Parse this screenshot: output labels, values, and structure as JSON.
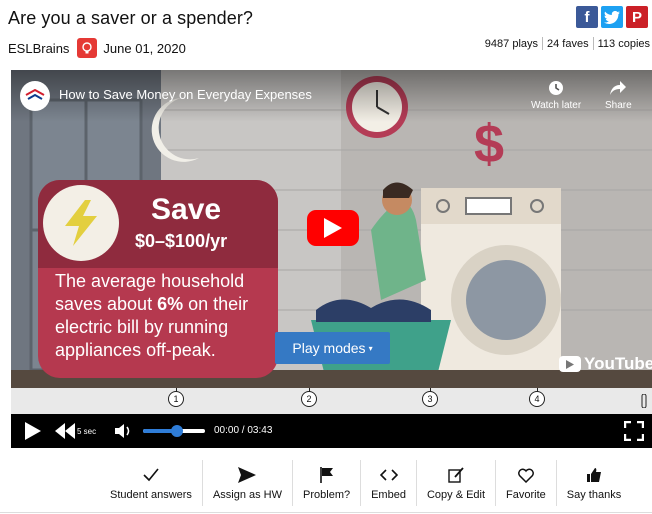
{
  "header": {
    "title": "Are you a saver or a spender?",
    "author": "ESLBrains",
    "date": "June 01, 2020",
    "share": {
      "facebook": "f",
      "twitter": "t",
      "pinterest": "P"
    },
    "stats": {
      "plays": "9487 plays",
      "faves": "24 faves",
      "copies": "113 copies"
    }
  },
  "video": {
    "title": "How to Save Money on Everyday Expenses",
    "watch_later": "Watch later",
    "share": "Share",
    "card": {
      "headline": "Save",
      "range": "$0–$100/yr",
      "body_pre": "The average household saves about ",
      "body_bold": "6%",
      "body_post": " on their electric bill by running appliances off-peak."
    },
    "play_modes": "Play modes",
    "youtube_wordmark": "YouTube"
  },
  "timeline": {
    "markers": [
      "1",
      "2",
      "3",
      "4"
    ],
    "marker_positions_pct": [
      25.8,
      46.5,
      65.4,
      82.1
    ]
  },
  "controls": {
    "rewind_label": "5 sec",
    "time": "00:00 / 03:43",
    "volume_fraction": 0.55
  },
  "actions": [
    {
      "label": "Student answers",
      "icon": "check-icon"
    },
    {
      "label": "Assign as HW",
      "icon": "send-icon"
    },
    {
      "label": "Problem?",
      "icon": "flag-icon"
    },
    {
      "label": "Embed",
      "icon": "code-icon"
    },
    {
      "label": "Copy & Edit",
      "icon": "edit-icon"
    },
    {
      "label": "Favorite",
      "icon": "heart-icon"
    },
    {
      "label": "Say thanks",
      "icon": "thumbs-up-icon"
    }
  ],
  "colors": {
    "card": "#b5394f",
    "card_dark": "#8f2b3e",
    "play_modes": "#3579c4",
    "youtube_red": "#ff0000",
    "slider": "#2f7dd8"
  }
}
